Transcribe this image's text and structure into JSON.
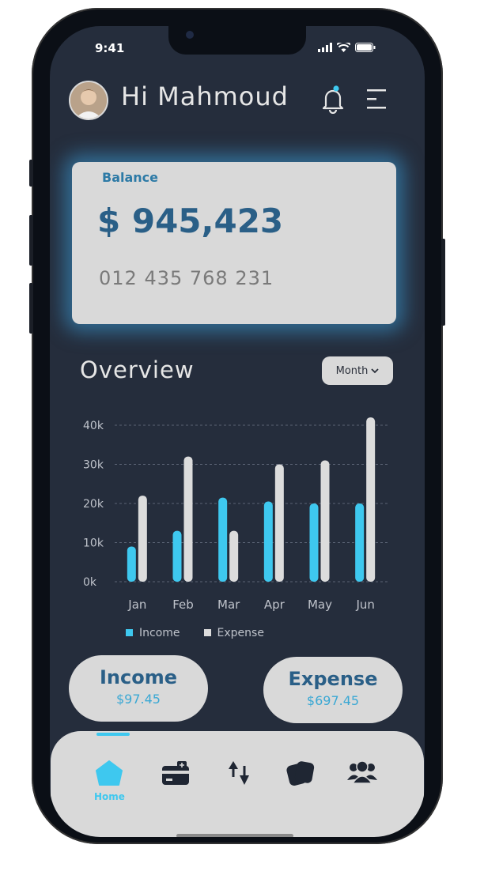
{
  "status_bar": {
    "time": "9:41"
  },
  "header": {
    "greeting": "Hi Mahmoud"
  },
  "balance": {
    "label": "Balance",
    "amount": "$ 945,423",
    "account_number": "012 435 768 231"
  },
  "overview": {
    "title": "Overview",
    "period_selector": "Month"
  },
  "chart_data": {
    "type": "bar",
    "categories": [
      "Jan",
      "Feb",
      "Mar",
      "Apr",
      "May",
      "Jun"
    ],
    "series": [
      {
        "name": "Income",
        "values": [
          9,
          13,
          21.5,
          20.5,
          20,
          20
        ],
        "color": "#3ec8ef"
      },
      {
        "name": "Expense",
        "values": [
          22,
          32,
          13,
          30,
          31,
          42
        ],
        "color": "#dcdcdc"
      }
    ],
    "y_ticks": [
      "0k",
      "10k",
      "20k",
      "30k",
      "40k"
    ],
    "ylim": [
      0,
      40
    ],
    "grid": true
  },
  "legend": {
    "income": "Income",
    "expense": "Expense"
  },
  "summary": {
    "income_label": "Income",
    "income_value": "$97.45",
    "expense_label": "Expense",
    "expense_value": "$697.45"
  },
  "nav": {
    "home_label": "Home"
  },
  "colors": {
    "accent": "#3ec8ef",
    "background": "#252d3c",
    "card": "#d9d9d9",
    "title_blue": "#2a5f87"
  },
  "icons": [
    "bell-icon",
    "menu-icon",
    "home-icon",
    "wallet-icon",
    "transfer-icon",
    "cards-icon",
    "users-icon"
  ]
}
